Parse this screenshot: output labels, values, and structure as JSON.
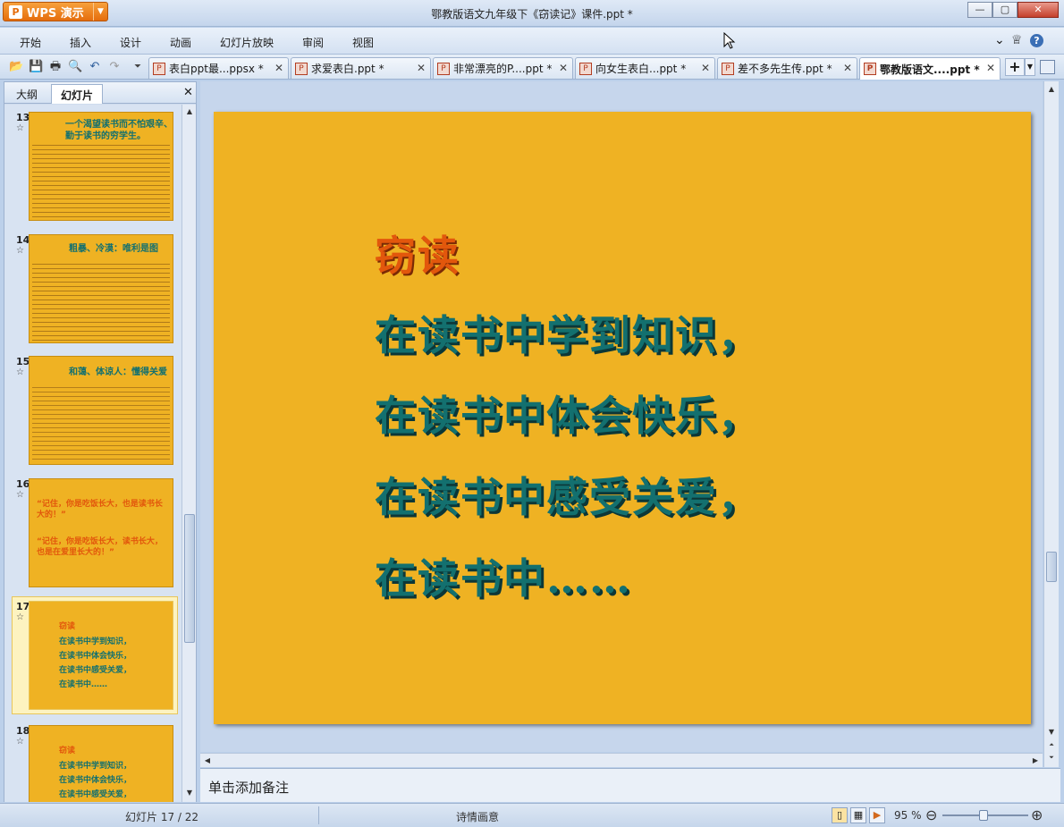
{
  "app": {
    "name": "WPS 演示",
    "window_title": "鄂教版语文九年级下《窃读记》课件.ppt *"
  },
  "window_controls": {
    "minimize": "—",
    "maximize": "▢",
    "close": "✕"
  },
  "menu": [
    "开始",
    "插入",
    "设计",
    "动画",
    "幻灯片放映",
    "审阅",
    "视图"
  ],
  "menu_right": {
    "collapse": "⌄",
    "skin": "♕",
    "help": "?"
  },
  "toolbar": {
    "open": "📂",
    "save": "💾",
    "print": "🖶",
    "preview": "🔍",
    "undo": "↶",
    "redo": "↷",
    "more": "⏷"
  },
  "tabs": [
    {
      "label": "表白ppt最...ppsx *",
      "active": false
    },
    {
      "label": "求爱表白.ppt *",
      "active": false
    },
    {
      "label": "非常漂亮的P....ppt *",
      "active": false
    },
    {
      "label": "向女生表白...ppt *",
      "active": false
    },
    {
      "label": "差不多先生传.ppt *",
      "active": false
    },
    {
      "label": "鄂教版语文....ppt *",
      "active": true
    }
  ],
  "tab_close": "✕",
  "tab_add": "+",
  "panel": {
    "tabs": [
      "大纲",
      "幻灯片"
    ],
    "active_tab": "幻灯片",
    "close": "✕"
  },
  "thumbnails": [
    {
      "number": "13",
      "star": "☆",
      "lines": [
        "一个渴望读书而不怕艰辛、",
        "勤于读书的穷学生。"
      ]
    },
    {
      "number": "14",
      "star": "☆",
      "lines": [
        "粗暴、冷漠：唯利是图"
      ]
    },
    {
      "number": "15",
      "star": "☆",
      "lines": [
        "和蔼、体谅人：懂得关爱"
      ]
    },
    {
      "number": "16",
      "star": "☆",
      "lines": [
        "“记住，你是吃饭长大，也是读书长大的！”",
        "“记住，你是吃饭长大，读书长大，也是在爱里长大的！”"
      ]
    },
    {
      "number": "17",
      "star": "☆",
      "selected": true,
      "lines": [
        "窃读",
        "在读书中学到知识，",
        "在读书中体会快乐，",
        "在读书中感受关爱，",
        "在读书中……"
      ]
    },
    {
      "number": "18",
      "star": "☆",
      "lines": [
        "窃读",
        "在读书中学到知识，",
        "在读书中体会快乐，",
        "在读书中感受关爱，"
      ]
    }
  ],
  "slide": {
    "title": "窃读",
    "lines": [
      "在读书中学到知识，",
      "在读书中体会快乐，",
      "在读书中感受关爱，",
      "在读书中……"
    ],
    "bg_color": "#efb223",
    "title_color": "#e2570c",
    "text_color": "#13706f"
  },
  "notes_placeholder": "单击添加备注",
  "status": {
    "slide_info": "幻灯片 17 / 22",
    "theme": "诗情画意",
    "zoom": "95 %",
    "zoom_minus": "⊖",
    "zoom_plus": "⊕"
  },
  "view_icons": {
    "normal": "▯",
    "sorter": "▦",
    "show": "▶"
  }
}
